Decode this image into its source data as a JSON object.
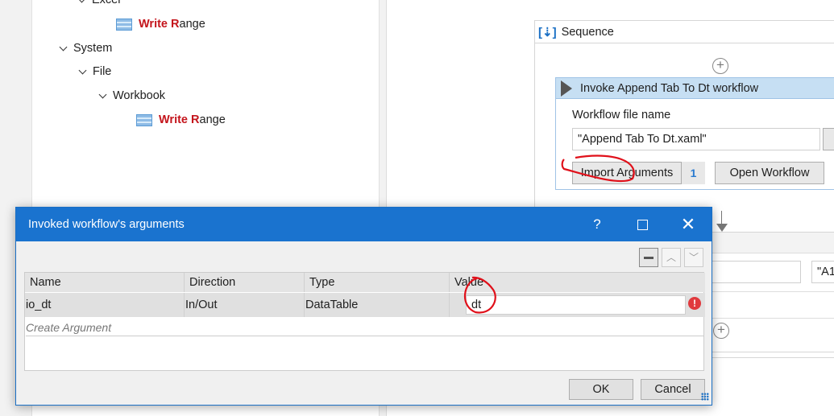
{
  "tree": {
    "excel": "Excel",
    "write_range_1": {
      "hl": "Write R",
      "rest": "ange"
    },
    "system": "System",
    "file": "File",
    "workbook": "Workbook",
    "write_range_2": {
      "hl": "Write R",
      "rest": "ange"
    }
  },
  "sequence": {
    "title": "Sequence"
  },
  "invoke": {
    "title": "Invoke Append Tab To Dt workflow",
    "file_label": "Workflow file name",
    "file_value": "\"Append Tab To Dt.xaml\"",
    "import_label": "Import Arguments",
    "arg_count": "1",
    "open_label": "Open Workflow"
  },
  "behind": {
    "range_value": "\"A1"
  },
  "dialog": {
    "title": "Invoked workflow's arguments",
    "help": "?",
    "columns": [
      "Name",
      "Direction",
      "Type",
      "Value"
    ],
    "rows": [
      {
        "name": "io_dt",
        "direction": "In/Out",
        "type": "DataTable",
        "value": "dt"
      }
    ],
    "create_placeholder": "Create Argument",
    "ok": "OK",
    "cancel": "Cancel"
  },
  "colors": {
    "titlebar": "#1a73cf",
    "highlight": "#c4151c",
    "annotation": "#e0101a"
  }
}
